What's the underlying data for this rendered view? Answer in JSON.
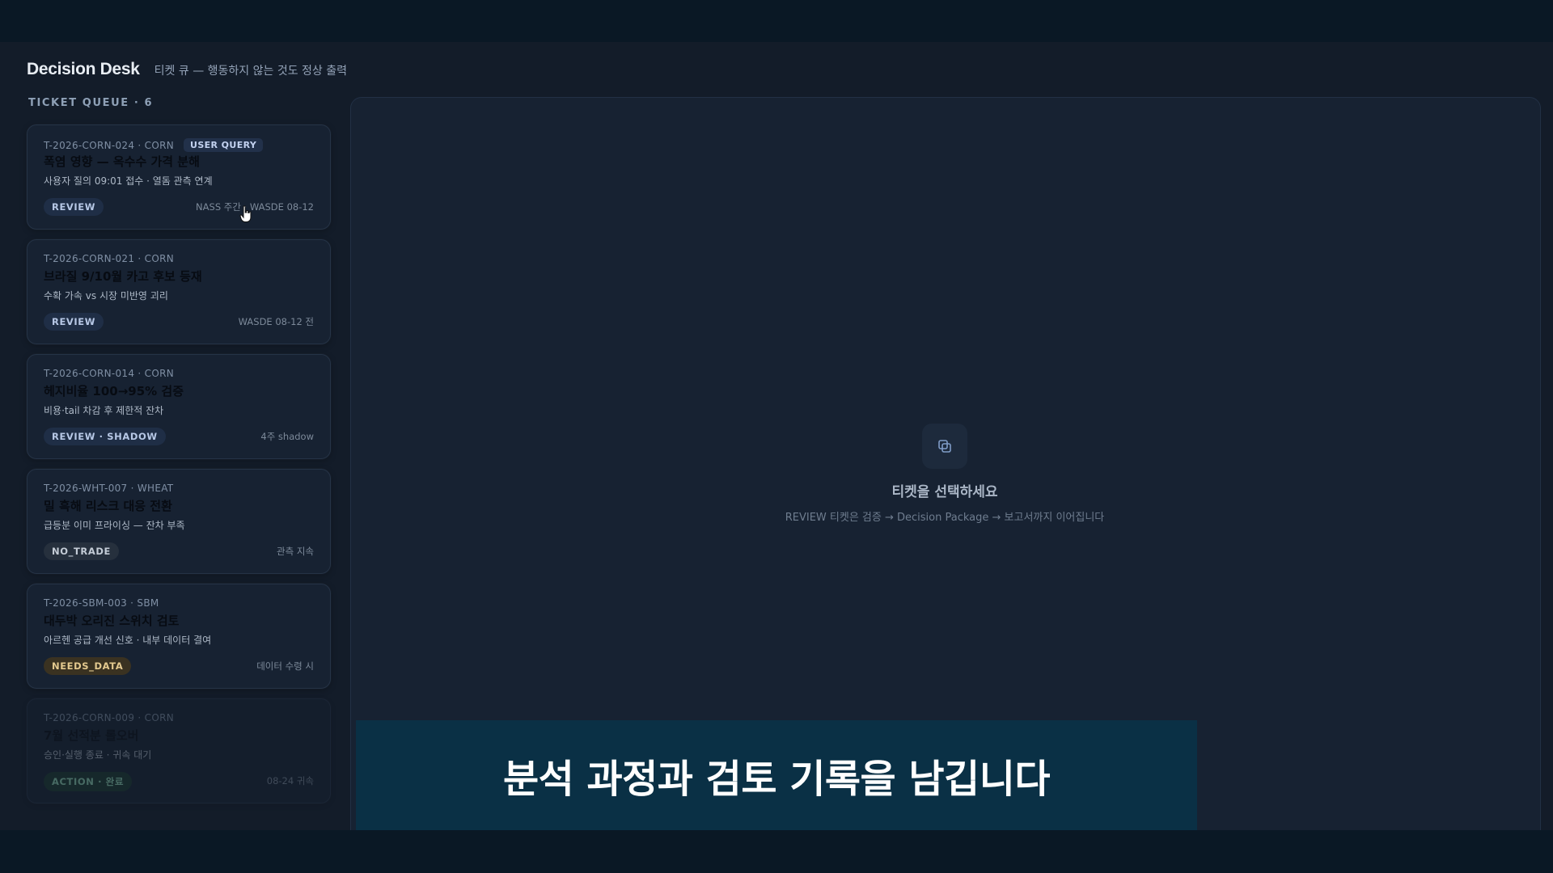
{
  "app": {
    "title": "Decision Desk",
    "subtitle": "티켓 큐 — 행동하지 않는 것도 정상 출력"
  },
  "queue": {
    "label": "TICKET QUEUE · 6",
    "tickets": [
      {
        "meta": "T-2026-CORN-024 · CORN",
        "tag": "USER QUERY",
        "title": "폭염 영향 — 옥수수 가격 분해",
        "desc": "사용자 질의 09:01 접수 · 열돔 관측 연계",
        "status": "REVIEW",
        "right": "NASS 주간 · WASDE 08-12"
      },
      {
        "meta": "T-2026-CORN-021 · CORN",
        "title": "브라질 9/10월 카고 후보 등재",
        "desc": "수확 가속 vs 시장 미반영 괴리",
        "status": "REVIEW",
        "right": "WASDE 08-12 전"
      },
      {
        "meta": "T-2026-CORN-014 · CORN",
        "title": "헤지비율 100→95% 검증",
        "desc": "비용·tail 차감 후 제한적 잔차",
        "status": "REVIEW · SHADOW",
        "right": "4주 shadow"
      },
      {
        "meta": "T-2026-WHT-007 · WHEAT",
        "title": "밀 흑해 리스크 대응 전환",
        "desc": "급등분 이미 프라이싱 — 잔차 부족",
        "status": "NO_TRADE",
        "right": "관측 지속"
      },
      {
        "meta": "T-2026-SBM-003 · SBM",
        "title": "대두박 오리진 스위치 검토",
        "desc": "아르헨 공급 개선 신호 · 내부 데이터 결여",
        "status": "NEEDS_DATA",
        "right": "데이터 수령 시"
      },
      {
        "meta": "T-2026-CORN-009 · CORN",
        "title": "7월 선적분 롤오버",
        "desc": "승인·실행 종료 · 귀속 대기",
        "status": "ACTION · 완료",
        "right": "08-24 귀속"
      }
    ]
  },
  "detail": {
    "empty_title": "티켓을 선택하세요",
    "empty_desc": "REVIEW 티켓은 검증 → Decision Package → 보고서까지 이어집니다",
    "icon": "copy-icon"
  },
  "caption": "분석 과정과 검토 기록을 남깁니다",
  "colors": {
    "background": "#131c29",
    "card": "#172232",
    "caption_bg": "#0a3045",
    "review_badge": "#1f2e46",
    "needs_badge": "#3a3221",
    "action_badge": "#1c3a2f"
  }
}
